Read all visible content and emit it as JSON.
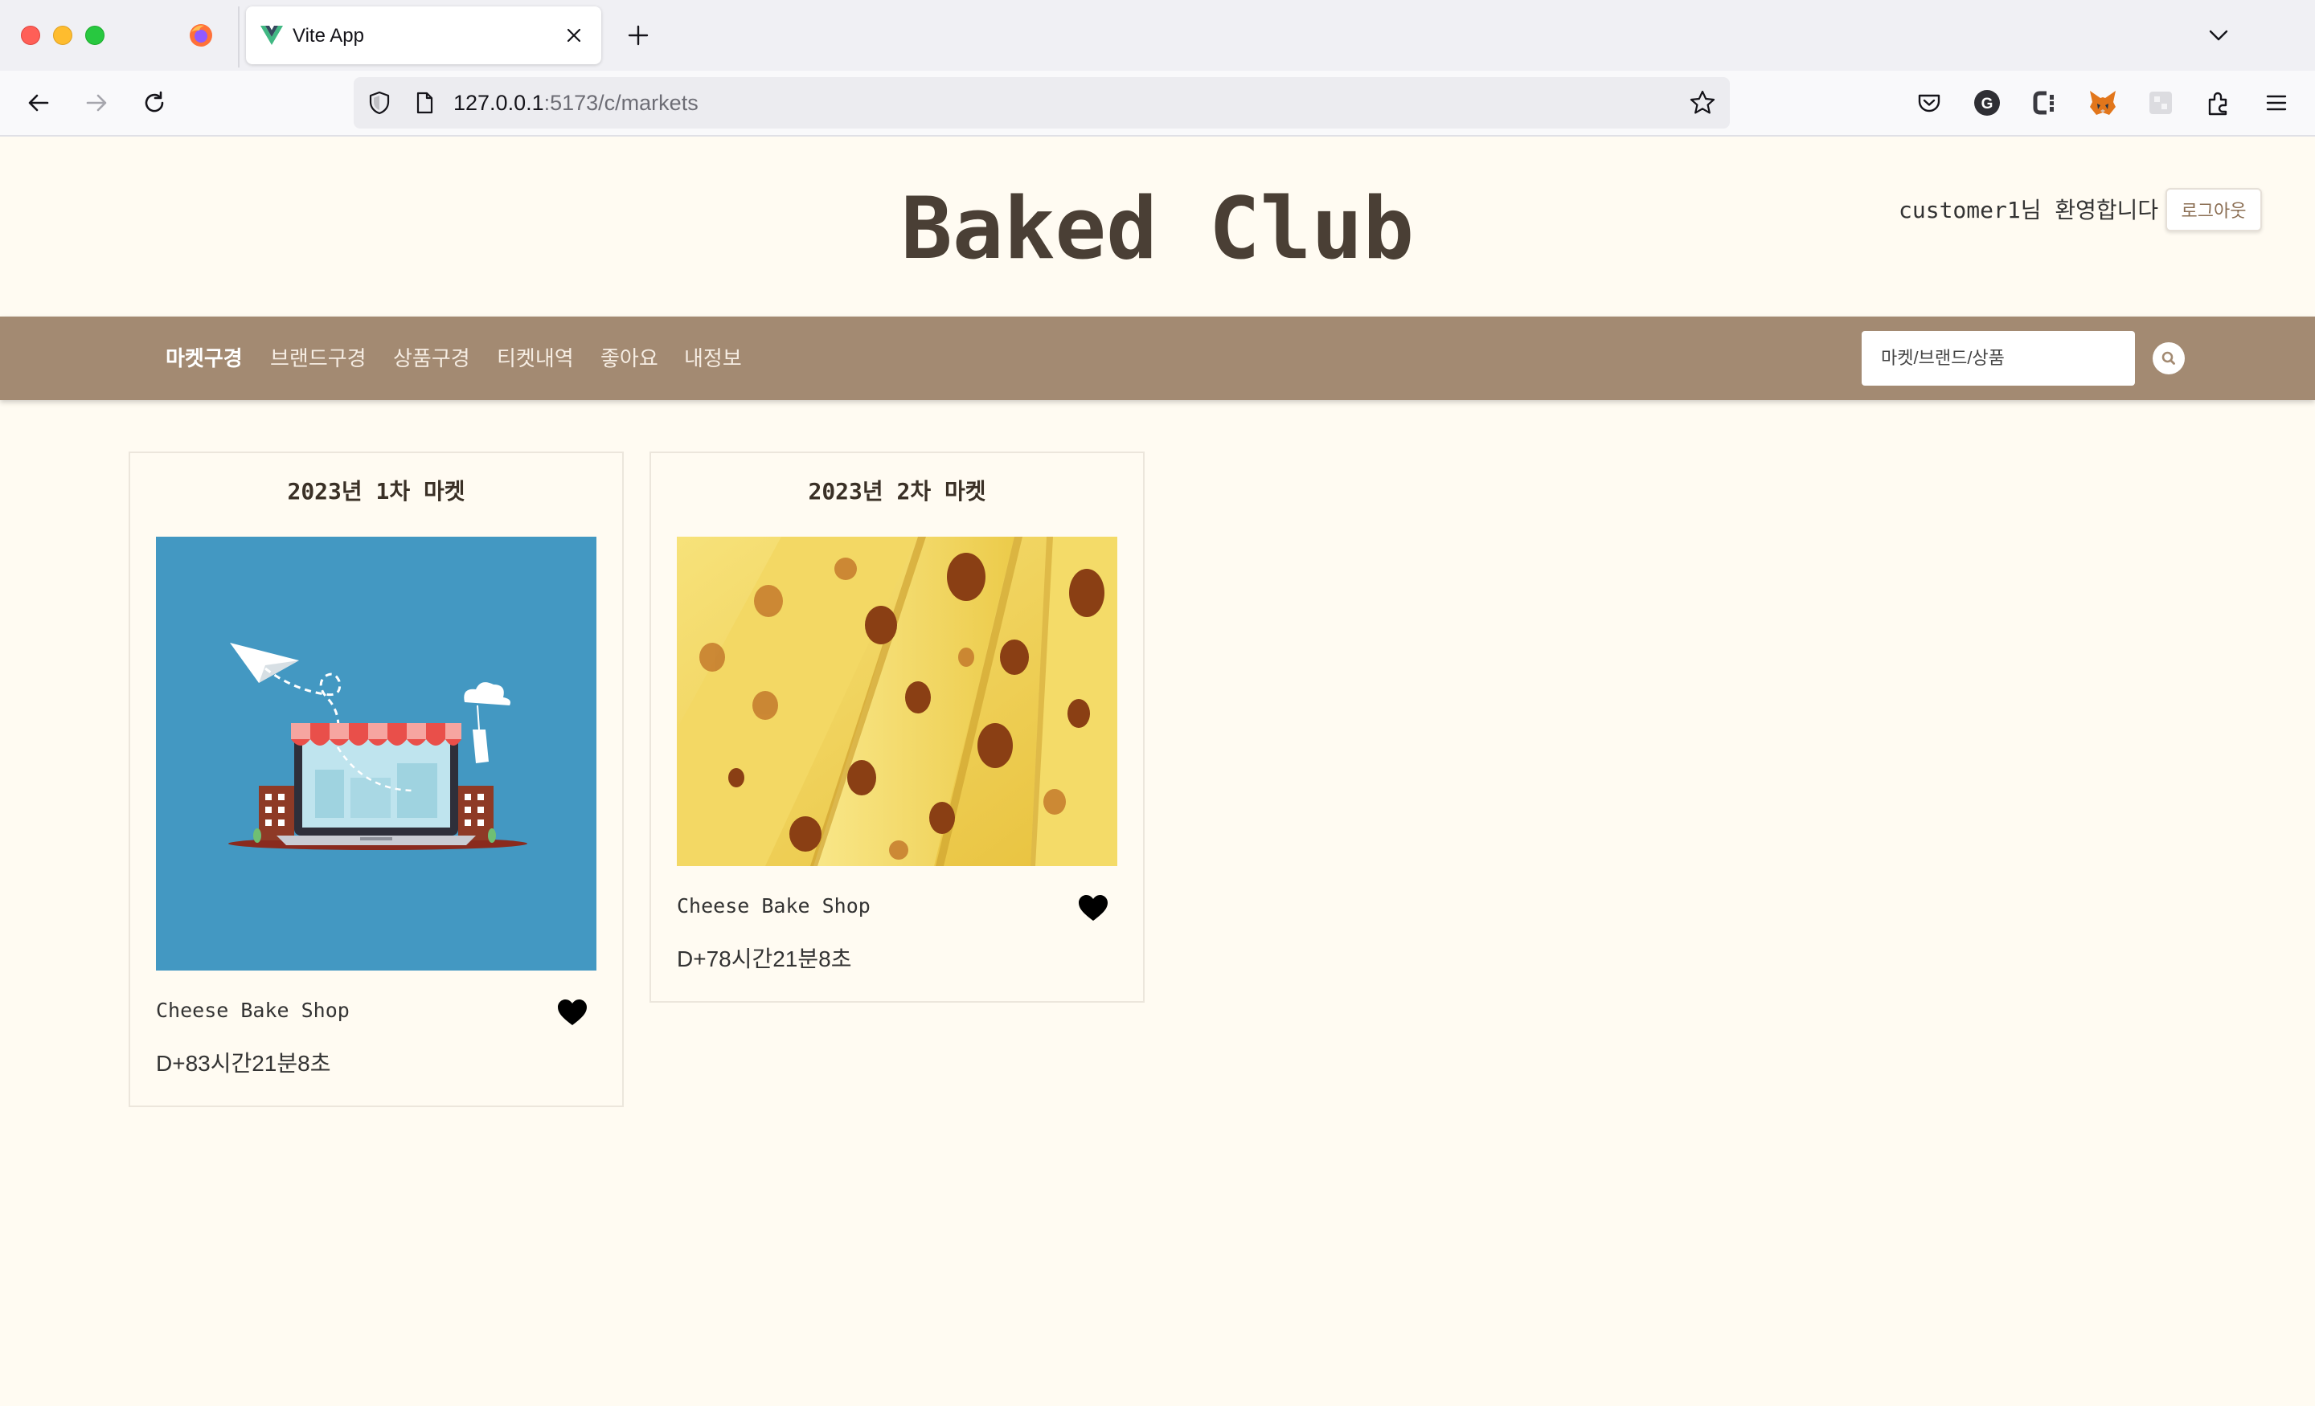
{
  "browser": {
    "tab_title": "Vite App",
    "url_host": "127.0.0.1",
    "url_path": ":5173/c/markets"
  },
  "header": {
    "site_title": "Baked Club",
    "welcome_text": "customer1님 환영합니다",
    "logout_label": "로그아웃"
  },
  "nav": {
    "items": [
      {
        "label": "마켓구경",
        "active": true
      },
      {
        "label": "브랜드구경",
        "active": false
      },
      {
        "label": "상품구경",
        "active": false
      },
      {
        "label": "티켓내역",
        "active": false
      },
      {
        "label": "좋아요",
        "active": false
      },
      {
        "label": "내정보",
        "active": false
      }
    ],
    "search_placeholder": "마켓/브랜드/상품"
  },
  "markets": [
    {
      "title": "2023년 1차 마켓",
      "shop": "Cheese Bake Shop",
      "dday": "D+83시간21분8초",
      "image": "market-illustration",
      "liked": true
    },
    {
      "title": "2023년 2차 마켓",
      "shop": "Cheese Bake Shop",
      "dday": "D+78시간21분8초",
      "image": "cheese-photo",
      "liked": true
    }
  ],
  "colors": {
    "page_bg": "#fffbf2",
    "navbar_bg": "#a38a72",
    "title_text": "#4a3f35",
    "market_image_bg": "#4398c2"
  }
}
